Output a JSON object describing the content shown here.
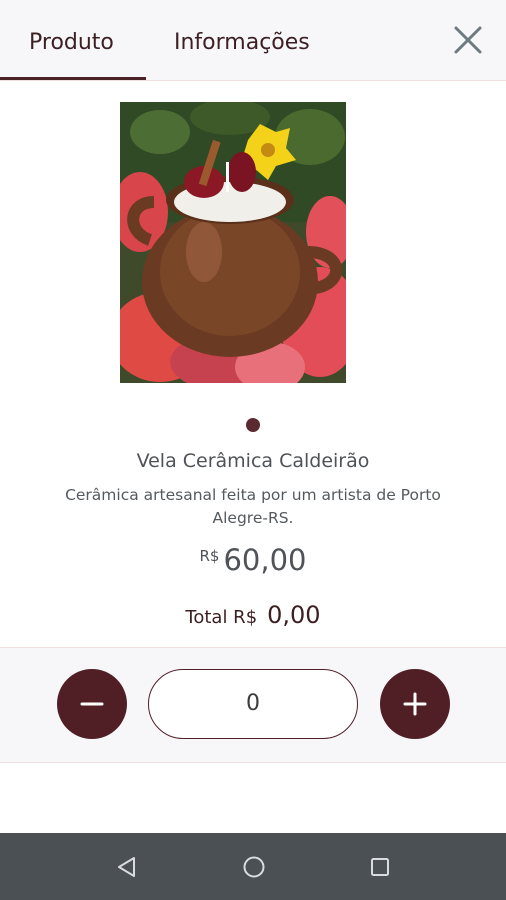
{
  "tabs": [
    {
      "label": "Produto",
      "active": true
    },
    {
      "label": "Informações",
      "active": false
    }
  ],
  "icons": {
    "close": "close-icon",
    "minus": "minus-icon",
    "plus": "plus-icon",
    "back": "back-triangle-icon",
    "home": "home-circle-icon",
    "recents": "recents-square-icon"
  },
  "product": {
    "name": "Vela Cerâmica Caldeirão",
    "description": "Cerâmica artesanal feita por um artista de Porto Alegre-RS.",
    "price_currency": "R$",
    "price_value": "60,00",
    "image_count": 1,
    "image_index": 1
  },
  "total": {
    "label": "Total R$",
    "value": "0,00"
  },
  "quantity": {
    "value": "0"
  },
  "colors": {
    "accent": "#4f1f25",
    "text_dark": "#3c1f22",
    "text_grey": "#4f5358",
    "nav_bar": "#4a5054",
    "panel_bg": "#f7f7fa"
  }
}
